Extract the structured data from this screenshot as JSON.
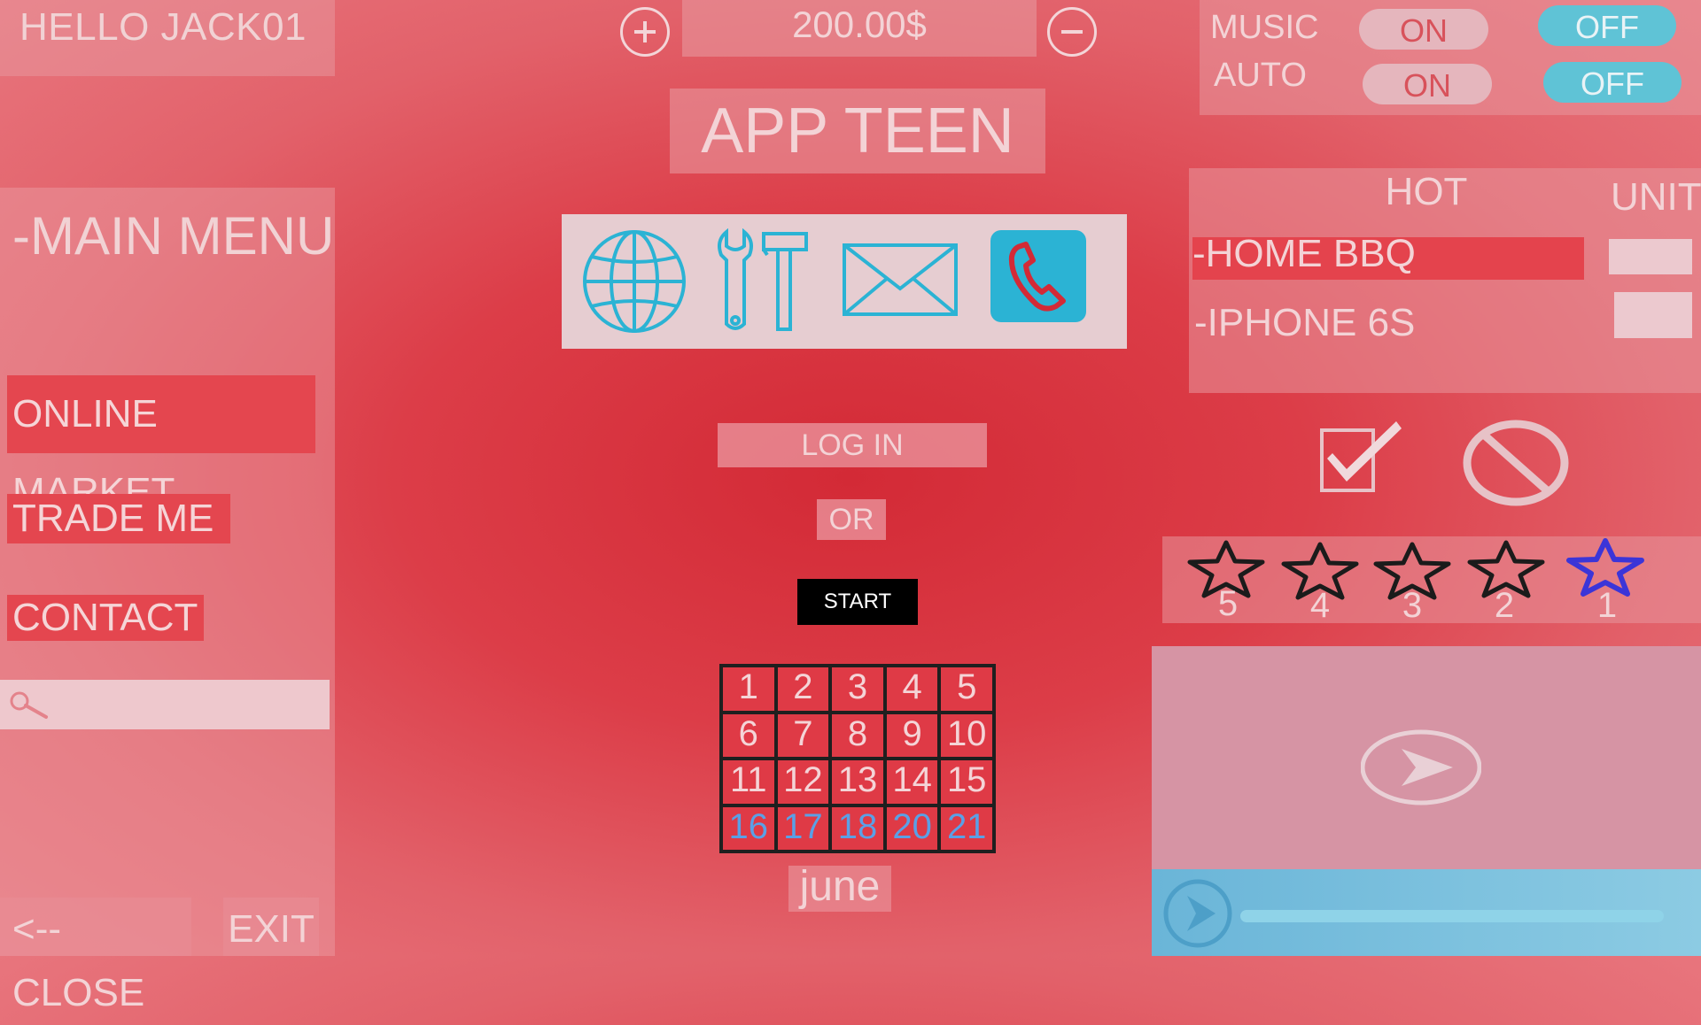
{
  "header": {
    "greeting": "HELLO JACK01",
    "price": "200.00$",
    "app_title": "APP TEEN"
  },
  "left_menu": {
    "title": "-MAIN MENU",
    "items": [
      "ONLINE MARKET",
      "TRADE ME",
      "CONTACT"
    ],
    "search_placeholder": "",
    "close_label": "<--CLOSE",
    "exit_label": "EXIT"
  },
  "toolbar_icons": [
    "globe-icon",
    "tools-icon",
    "mail-icon",
    "phone-icon"
  ],
  "center": {
    "login_label": "LOG IN",
    "or_label": "OR",
    "start_label": "START"
  },
  "calendar": {
    "days": [
      "1",
      "2",
      "3",
      "4",
      "5",
      "6",
      "7",
      "8",
      "9",
      "10",
      "11",
      "12",
      "13",
      "14",
      "15",
      "16",
      "17",
      "18",
      "20",
      "21"
    ],
    "month": "june"
  },
  "settings": {
    "music_label": "MUSIC",
    "auto_label": "AUTO",
    "on_label": "ON",
    "off_label": "OFF"
  },
  "hot": {
    "title": "HOT",
    "unit_title": "UNIT",
    "items": [
      "-HOME BBQ",
      "-IPHONE 6S"
    ]
  },
  "rating": {
    "labels": [
      "5",
      "4",
      "3",
      "2",
      "1"
    ],
    "selected": "1"
  },
  "colors": {
    "accent_teal": "#2bb3d4",
    "star_selected": "#3b35d8",
    "background": "#d32a36"
  }
}
